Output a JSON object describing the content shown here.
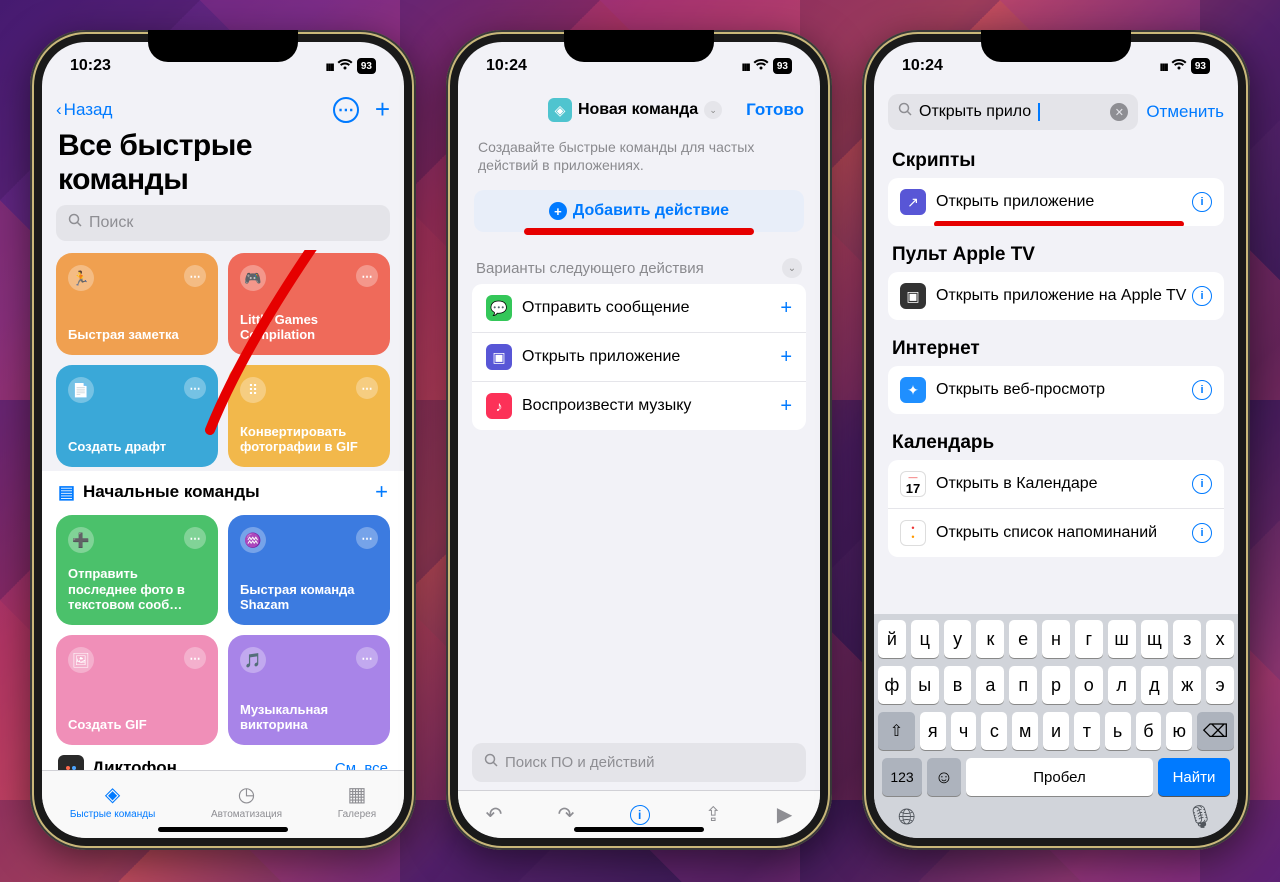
{
  "status": {
    "time1": "10:23",
    "time2": "10:24",
    "time3": "10:24",
    "battery": "93"
  },
  "p1": {
    "back": "Назад",
    "title": "Все быстрые команды",
    "search_placeholder": "Поиск",
    "cards": [
      {
        "label": "Быстрая заметка",
        "sub": "",
        "color": "#f0a050"
      },
      {
        "label": "Little Games Compilation",
        "sub": "",
        "color": "#ef6a5a"
      },
      {
        "label": "Создать драфт",
        "sub": "",
        "color": "#3aa8d8"
      },
      {
        "label": "Конвертировать фотографии в GIF",
        "sub": "",
        "color": "#f2b84b"
      }
    ],
    "section1": "Начальные команды",
    "cards2": [
      {
        "label": "Отправить последнее фото в текстовом сооб…",
        "color": "#4bc16b"
      },
      {
        "label": "Быстрая команда Shazam",
        "color": "#3c7be0"
      },
      {
        "label": "Создать GIF",
        "color": "#f08fb8"
      },
      {
        "label": "Музыкальная викторина",
        "color": "#a884e8"
      }
    ],
    "dictaphone": "Диктофон",
    "see_all": "См. все",
    "tabs": [
      "Быстрые команды",
      "Автоматизация",
      "Галерея"
    ]
  },
  "p2": {
    "title": "Новая команда",
    "done": "Готово",
    "hint": "Создавайте быстрые команды для частых действий в приложениях.",
    "add_action": "Добавить действие",
    "variants_title": "Варианты следующего действия",
    "suggestions": [
      {
        "label": "Отправить сообщение",
        "color": "#34c759"
      },
      {
        "label": "Открыть приложение",
        "color": "#5856d6"
      },
      {
        "label": "Воспроизвести музыку",
        "color": "#fc3158"
      }
    ],
    "search_placeholder": "Поиск ПО и действий"
  },
  "p3": {
    "search_value": "Открыть прило",
    "cancel": "Отменить",
    "cat1": "Скрипты",
    "cat1_items": [
      {
        "label": "Открыть приложение",
        "color": "#5856d6",
        "underline": true
      }
    ],
    "cat2": "Пульт Apple TV",
    "cat2_items": [
      {
        "label": "Открыть приложение на Apple TV"
      }
    ],
    "cat3": "Интернет",
    "cat3_items": [
      {
        "label": "Открыть веб-просмотр"
      }
    ],
    "cat4": "Календарь",
    "cat4_items": [
      {
        "label": "Открыть в Календаре"
      },
      {
        "label": "Открыть список напоминаний"
      }
    ],
    "kb": {
      "row1": [
        "й",
        "ц",
        "у",
        "к",
        "е",
        "н",
        "г",
        "ш",
        "щ",
        "з",
        "х"
      ],
      "row2": [
        "ф",
        "ы",
        "в",
        "а",
        "п",
        "р",
        "о",
        "л",
        "д",
        "ж",
        "э"
      ],
      "row3": [
        "я",
        "ч",
        "с",
        "м",
        "и",
        "т",
        "ь",
        "б",
        "ю"
      ],
      "n123": "123",
      "space": "Пробел",
      "find": "Найти"
    }
  }
}
